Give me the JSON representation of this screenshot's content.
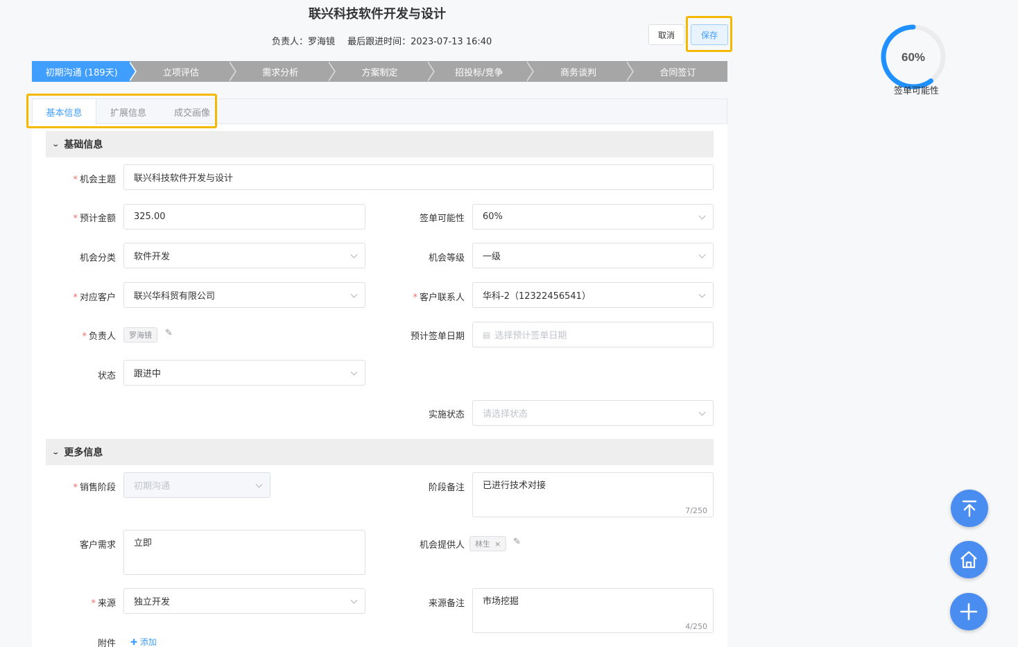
{
  "header": {
    "title": "联兴科技软件开发与设计",
    "owner": "负责人：罗海镜",
    "last_follow": "最后跟进时间：2023-07-13 16:40",
    "cancel_label": "取消",
    "save_label": "保存"
  },
  "steps": [
    "初期沟通 (189天)",
    "立项评估",
    "需求分析",
    "方案制定",
    "招投标/竞争",
    "商务谈判",
    "合同签订"
  ],
  "tabs": [
    "基本信息",
    "扩展信息",
    "成交画像"
  ],
  "gauge": {
    "value": "60%",
    "label": "签单可能性",
    "fraction": 0.6
  },
  "basic": {
    "section_title": "基础信息",
    "subject_label": "机会主题",
    "subject_value": "联兴科技软件开发与设计",
    "amount_label": "预计金额",
    "amount_value": "325.00",
    "probability_label": "签单可能性",
    "probability_value": "60%",
    "category_label": "机会分类",
    "category_value": "软件开发",
    "level_label": "机会等级",
    "level_value": "一级",
    "customer_label": "对应客户",
    "customer_value": "联兴华科贸有限公司",
    "contact_label": "客户联系人",
    "contact_value": "华科-2（12322456541）",
    "owner_label": "负责人",
    "owner_tag": "罗海镜",
    "sign_date_label": "预计签单日期",
    "sign_date_placeholder": "选择预计签单日期",
    "status_label": "状态",
    "status_value": "跟进中",
    "impl_label": "实施状态",
    "impl_placeholder": "请选择状态"
  },
  "more": {
    "section_title": "更多信息",
    "stage_label": "销售阶段",
    "stage_value": "初期沟通",
    "stage_note_label": "阶段备注",
    "stage_note_value": "已进行技术对接",
    "stage_note_count": "7/250",
    "need_label": "客户需求",
    "need_value": "立即",
    "provider_label": "机会提供人",
    "provider_tag": "林生",
    "source_label": "来源",
    "source_value": "独立开发",
    "source_note_label": "来源备注",
    "source_note_value": "市场挖掘",
    "source_note_count": "4/250",
    "attach_label": "附件",
    "attach_add": "添加"
  }
}
